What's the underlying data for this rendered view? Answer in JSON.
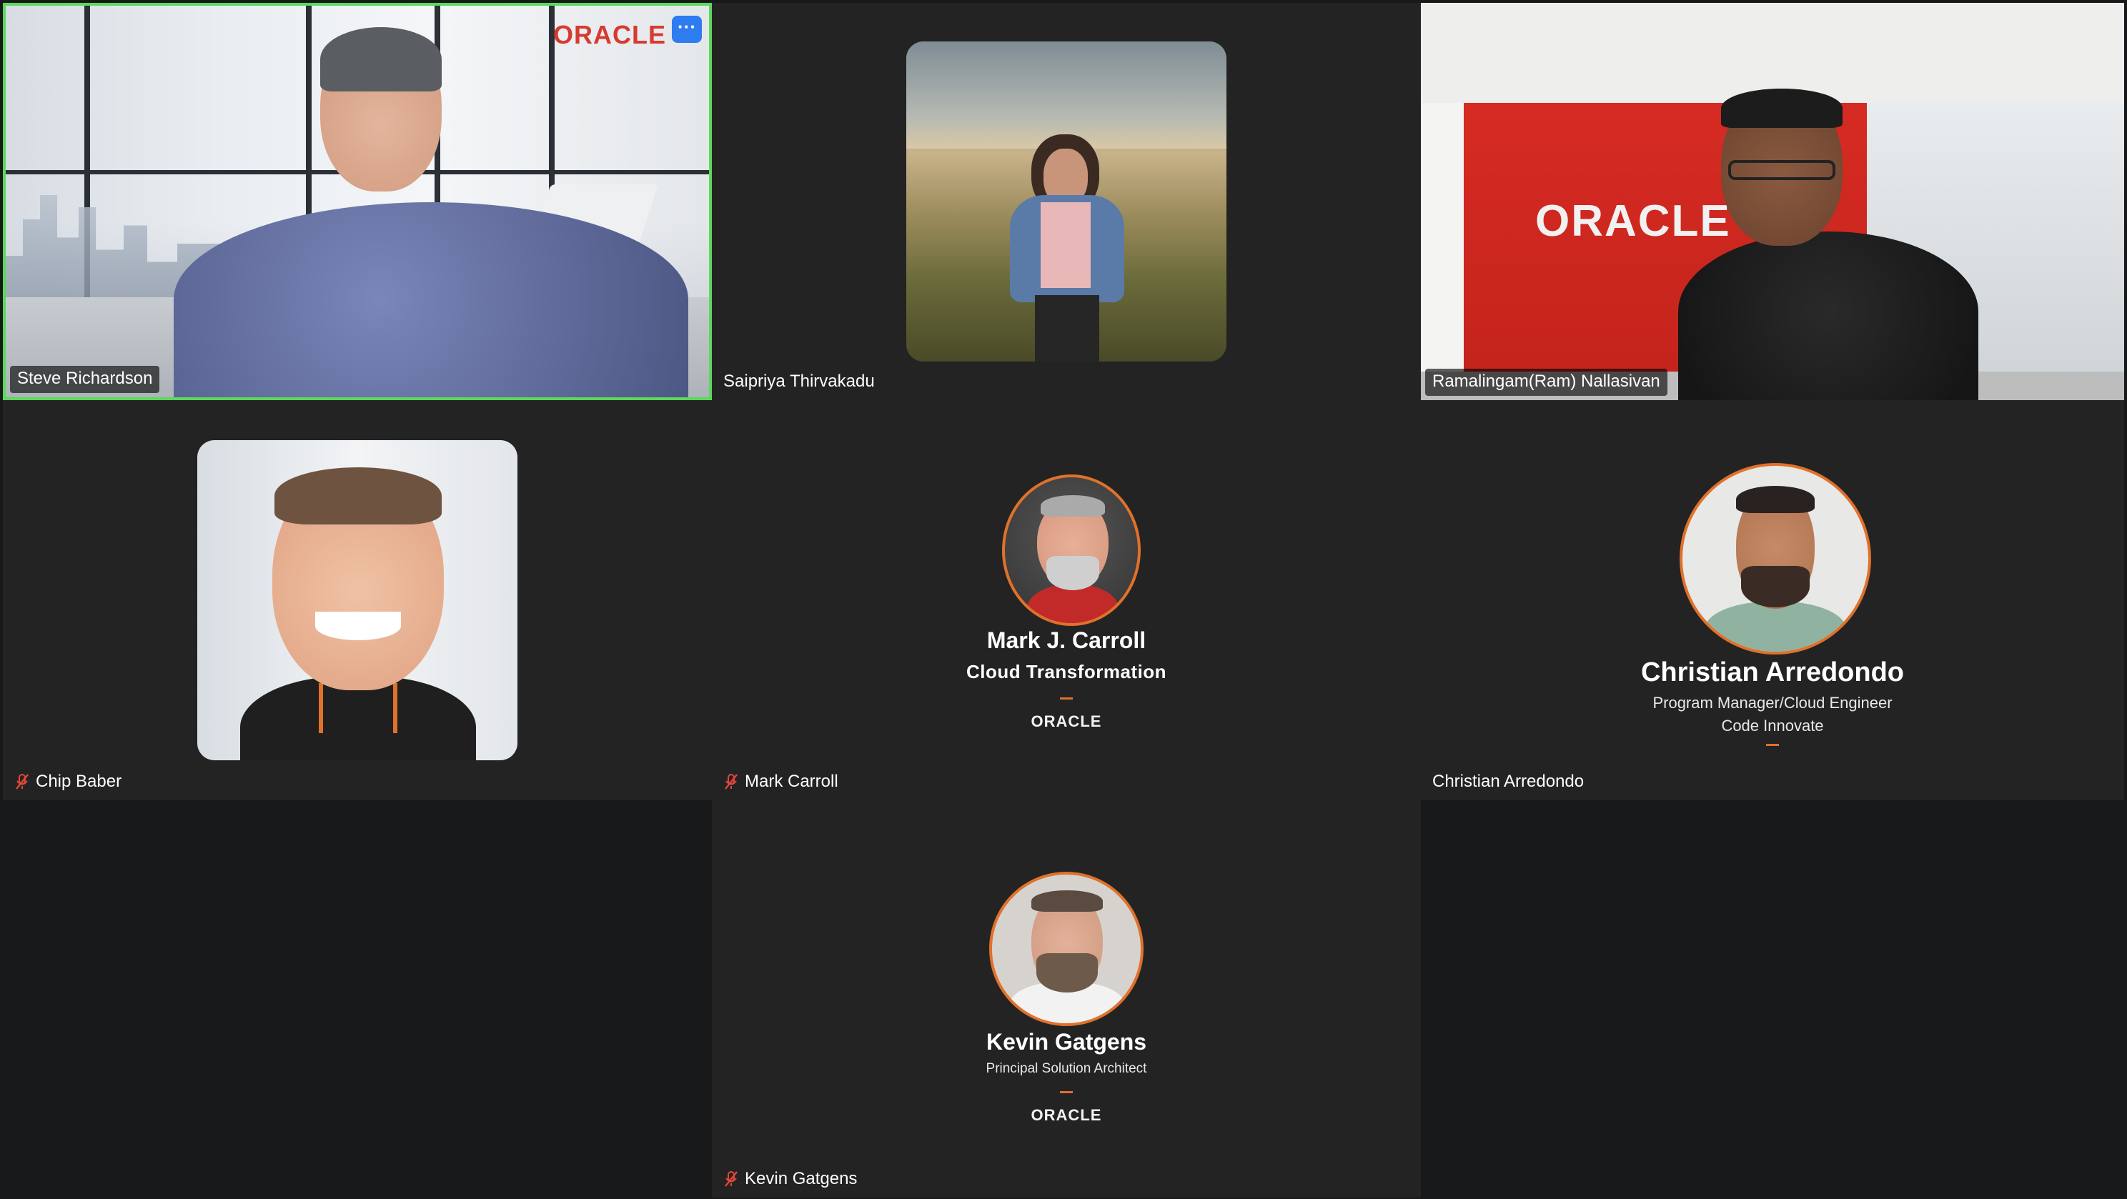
{
  "app": {
    "title": "Video meeting gallery view",
    "accent_active_speaker": "#5bd95b",
    "tile_background": "#232323",
    "page_background": "#17181a",
    "oracle_red": "#d73a30",
    "orange_accent": "#e0712b"
  },
  "participants": [
    {
      "id": "steve",
      "display_name": "Steve Richardson",
      "muted": false,
      "video_on": true,
      "active_speaker": true,
      "background_logo": "ORACLE",
      "more_button_icon": "more-dots-icon",
      "more_button_label": "···"
    },
    {
      "id": "saipriya",
      "display_name": "Saipriya Thirvakadu",
      "muted": false,
      "video_on": false,
      "avatar": "photo-square"
    },
    {
      "id": "ram",
      "display_name": "Ramalingam(Ram) Nallasivan",
      "muted": false,
      "video_on": true,
      "background_logo": "ORACLE"
    },
    {
      "id": "chip",
      "display_name": "Chip Baber",
      "muted": true,
      "video_on": false,
      "avatar": "photo-square"
    },
    {
      "id": "mark",
      "display_name": "Mark Carroll",
      "muted": true,
      "video_on": false,
      "card": {
        "name": "Mark J. Carroll",
        "title": "Cloud Transformation",
        "company": "ORACLE"
      }
    },
    {
      "id": "christian",
      "display_name": "Christian Arredondo",
      "muted": false,
      "video_on": false,
      "card": {
        "name": "Christian Arredondo",
        "title_line1": "Program Manager/Cloud Engineer",
        "title_line2": "Code Innovate"
      }
    },
    {
      "id": "kevin",
      "display_name": "Kevin Gatgens",
      "muted": true,
      "video_on": false,
      "card": {
        "name": "Kevin Gatgens",
        "title": "Principal Solution Architect",
        "company": "ORACLE"
      }
    }
  ]
}
